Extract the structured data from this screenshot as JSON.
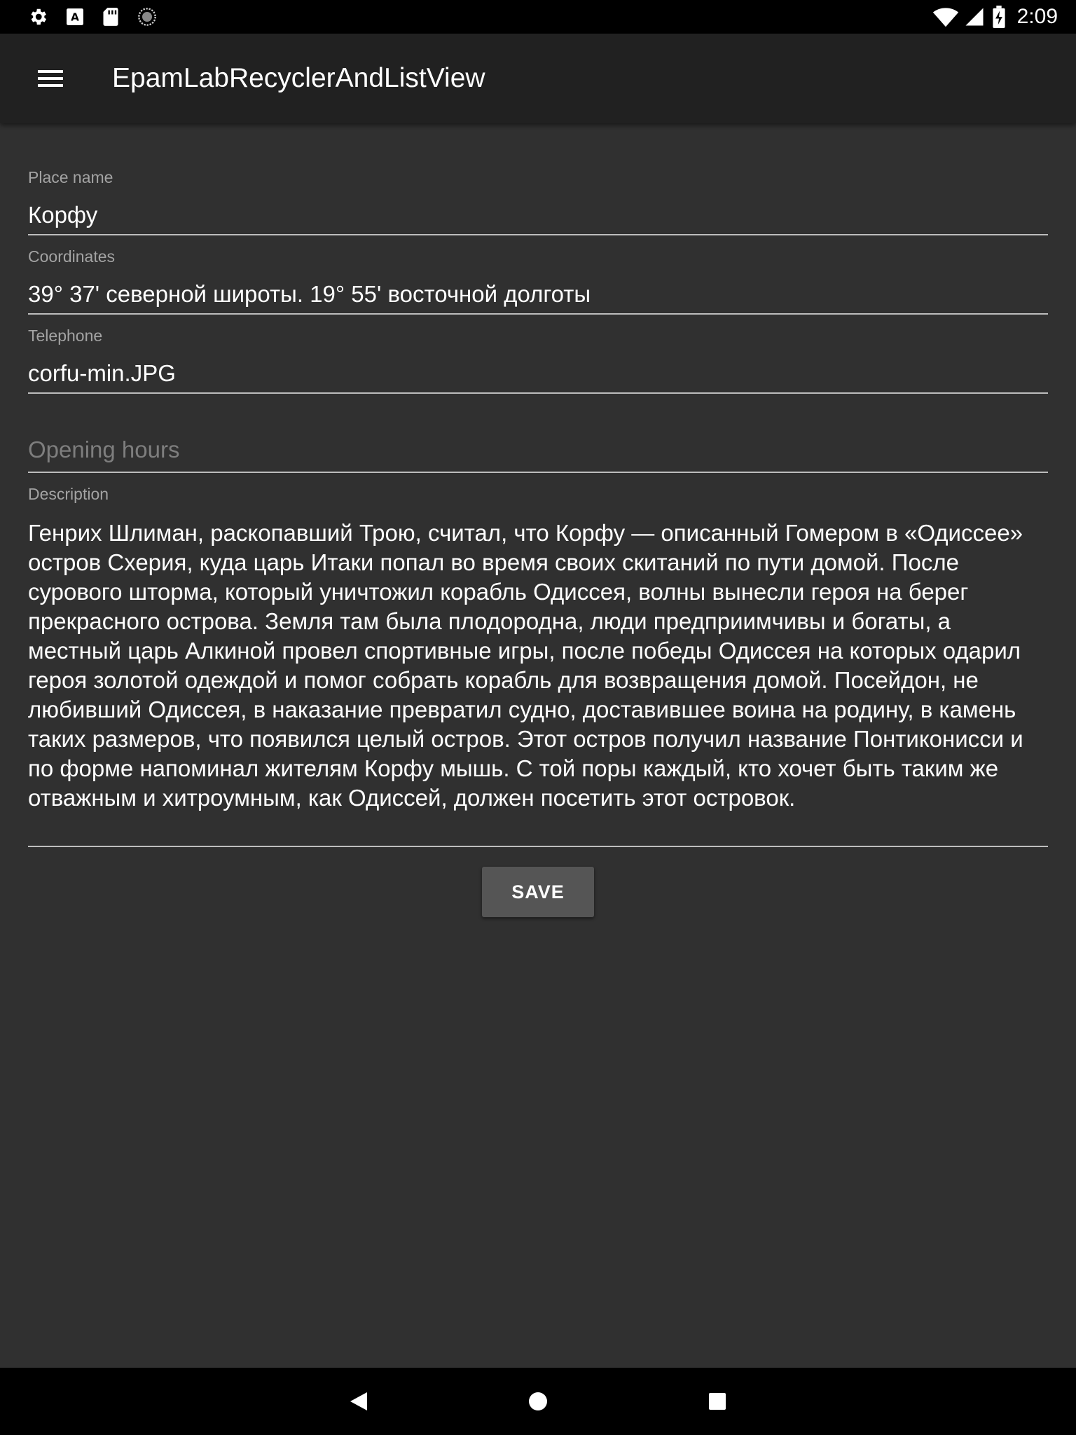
{
  "status_bar": {
    "time": "2:09",
    "left_icons": [
      "settings-icon",
      "a-notification-icon",
      "sd-card-icon",
      "sync-circle-icon"
    ],
    "right_icons": [
      "wifi-icon",
      "cell-signal-icon",
      "battery-charging-icon"
    ]
  },
  "app_bar": {
    "title": "EpamLabRecyclerAndListView",
    "menu_icon": "hamburger-menu-icon"
  },
  "form": {
    "place_name": {
      "label": "Place name",
      "value": "Корфу"
    },
    "coordinates": {
      "label": "Coordinates",
      "value": "39° 37' северной широты. 19° 55' восточной долготы"
    },
    "telephone": {
      "label": "Telephone",
      "value": "corfu-min.JPG"
    },
    "opening_hours": {
      "placeholder": "Opening hours",
      "value": ""
    },
    "description": {
      "label": "Description",
      "value": "Генрих Шлиман, раскопавший Трою, считал, что Корфу — описанный Гомером в «Одиссее» остров Схерия, куда царь Итаки попал во время своих скитаний по пути домой. После сурового шторма, который уничтожил корабль Одиссея, волны вынесли героя на берег прекрасного острова. Земля там была плодородна, люди предприимчивы и богаты, а местный царь Алкиной провел спортивные игры, после победы Одиссея на которых одарил героя золотой одеждой и помог собрать корабль для возвращения домой. Посейдон, не любивший Одиссея, в наказание превратил судно, доставившее воина на родину, в камень таких размеров, что появился целый остров. Этот остров получил название Понтиконисси и по форме напоминал жителям Корфу мышь. С той поры каждый, кто хочет быть таким же отважным и хитроумным, как Одиссей, должен посетить этот островок."
    },
    "save_label": "SAVE"
  },
  "nav_bar": {
    "icons": [
      "back-icon",
      "home-icon",
      "recents-icon"
    ]
  },
  "colors": {
    "background": "#303030",
    "app_bar": "#212121",
    "system_bars": "#000000",
    "button": "#555555",
    "hint_text": "#a3a3a3",
    "underline": "#bdbdbd"
  }
}
